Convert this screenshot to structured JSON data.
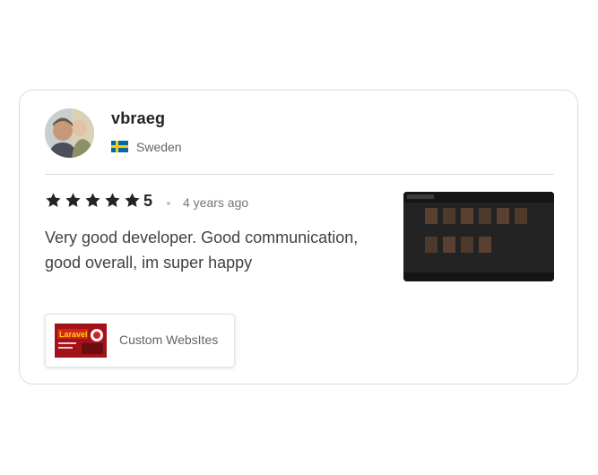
{
  "review": {
    "username": "vbraeg",
    "country": "Sweden",
    "country_flag_icon": "sweden-flag-icon",
    "rating": "5",
    "star_count": 5,
    "time_ago": "4 years ago",
    "text": "Very good developer. Good communication, good overall, im super happy",
    "gig": {
      "title": "Custom WebsItes",
      "thumbnail_text": "Laravel"
    }
  },
  "colors": {
    "star": "#222325",
    "border": "#dadbdd",
    "flag_blue": "#006aa7",
    "flag_yellow": "#fecc00",
    "gig_red": "#a3121a"
  }
}
